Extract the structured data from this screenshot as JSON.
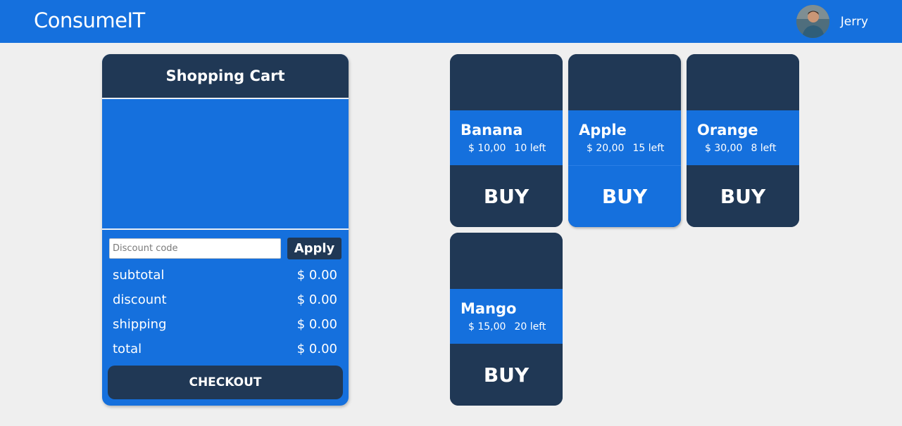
{
  "app": {
    "brand": "ConsumeIT"
  },
  "user": {
    "name": "Jerry",
    "avatar_icon": "user-avatar-photo"
  },
  "cart": {
    "title": "Shopping Cart",
    "discount": {
      "placeholder": "Discount code",
      "value": "",
      "apply_label": "Apply"
    },
    "summary": [
      {
        "label": "subtotal",
        "value": "$ 0.00"
      },
      {
        "label": "discount",
        "value": "$ 0.00"
      },
      {
        "label": "shipping",
        "value": "$ 0.00"
      },
      {
        "label": "total",
        "value": "$ 0.00"
      }
    ],
    "checkout_label": "CHECKOUT"
  },
  "products": [
    {
      "name": "Banana",
      "price": "$ 10,00",
      "stock": "10 left",
      "buy_label": "BUY"
    },
    {
      "name": "Apple",
      "price": "$ 20,00",
      "stock": "15 left",
      "buy_label": "BUY"
    },
    {
      "name": "Orange",
      "price": "$ 30,00",
      "stock": "8 left",
      "buy_label": "BUY"
    },
    {
      "name": "Mango",
      "price": "$ 15,00",
      "stock": "20 left",
      "buy_label": "BUY"
    }
  ],
  "colors": {
    "primary": "#1570dd",
    "dark": "#203855",
    "background": "#efefef"
  }
}
